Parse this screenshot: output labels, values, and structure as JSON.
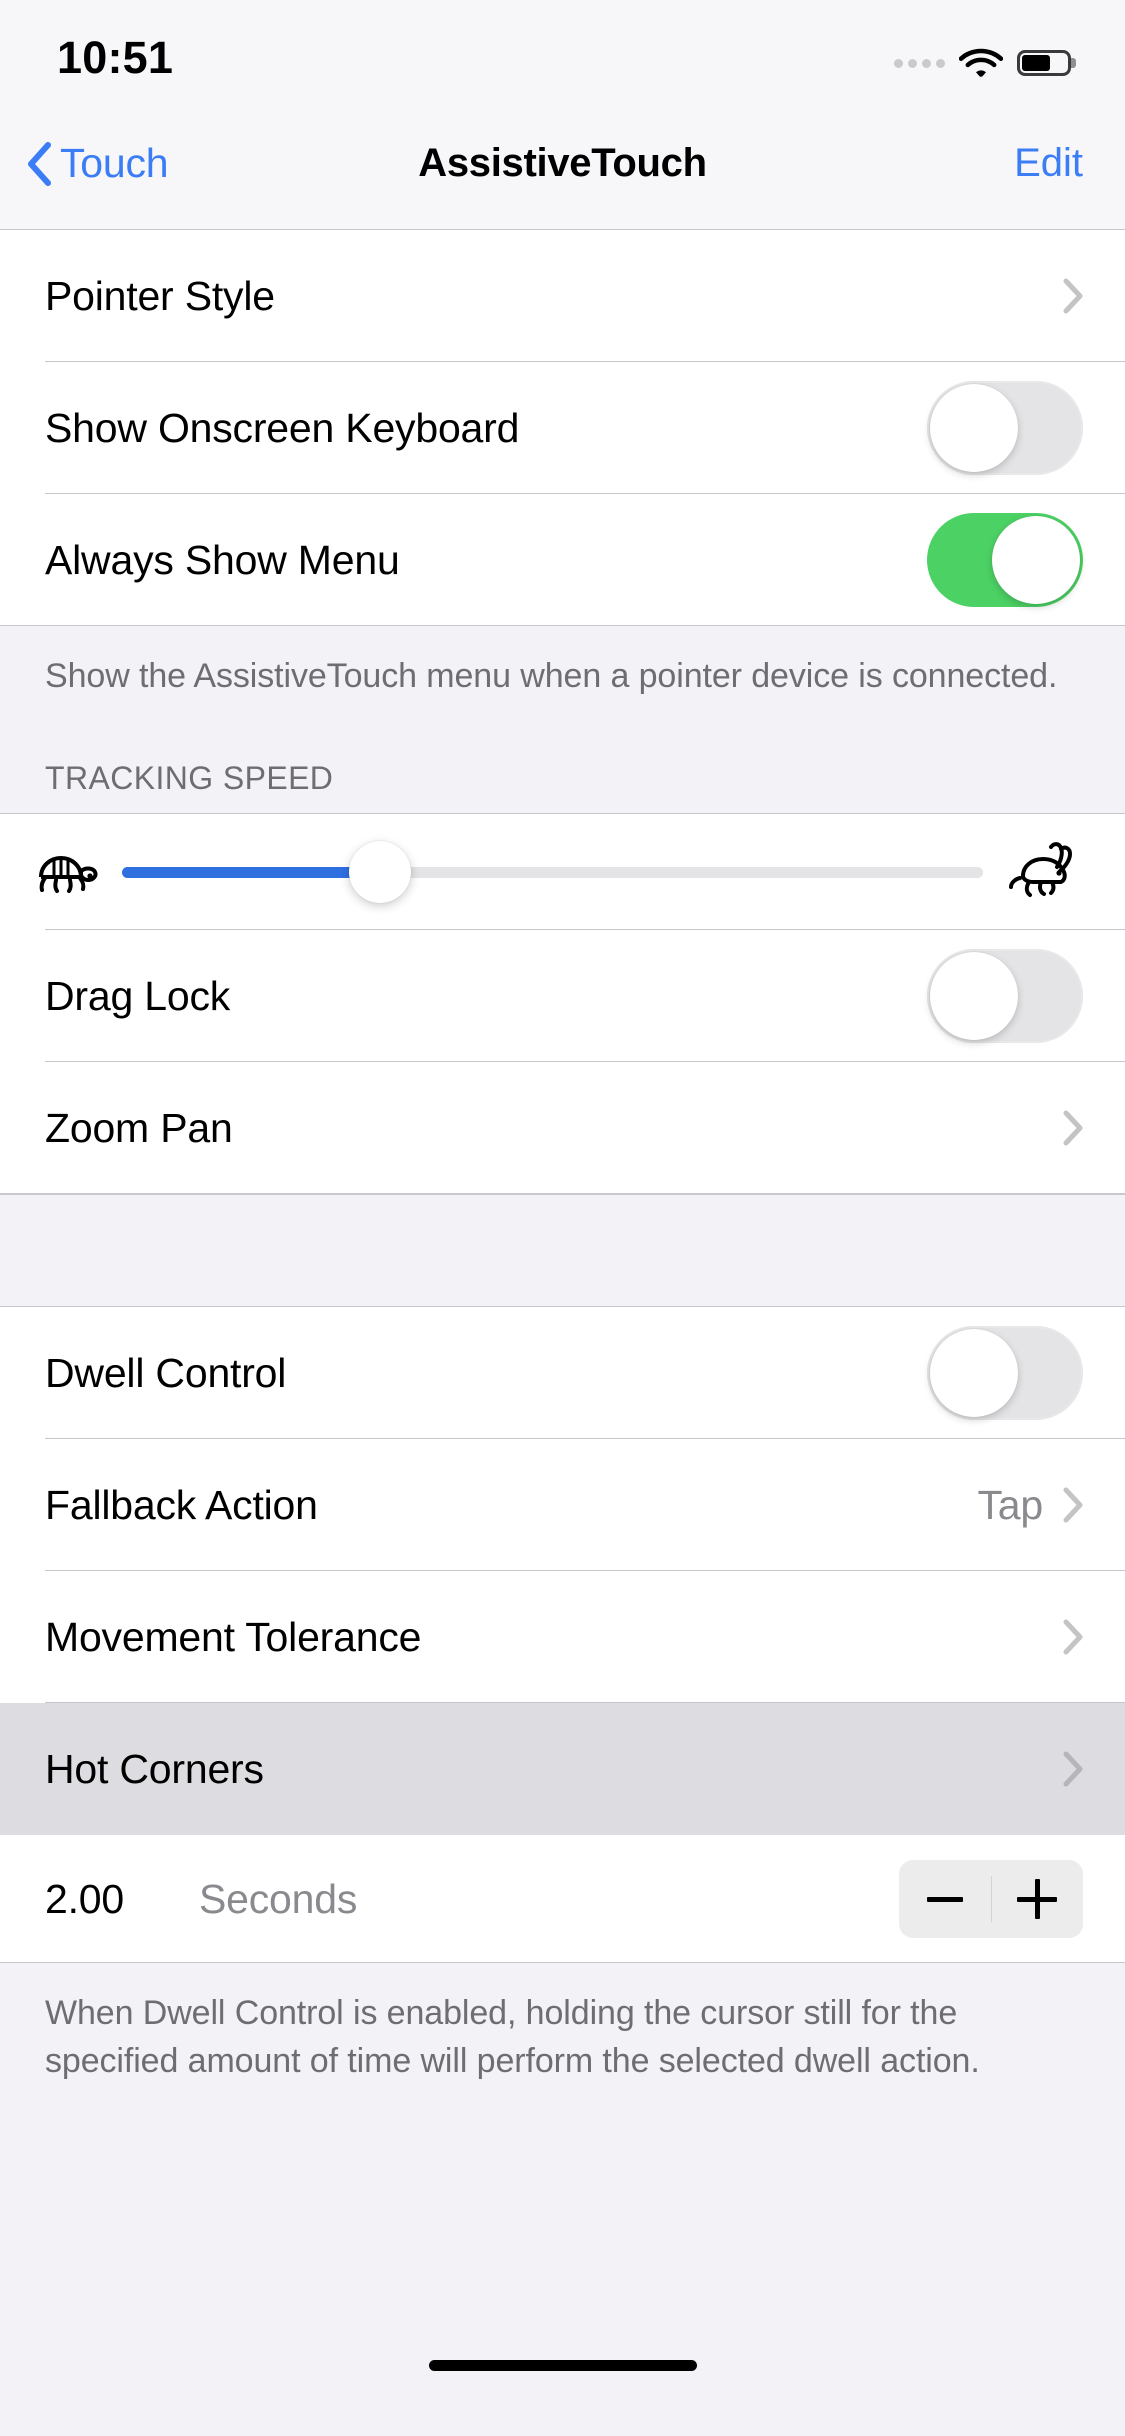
{
  "status_bar": {
    "time": "10:51",
    "cellular_icon": "cellular-dots-icon",
    "wifi_icon": "wifi-icon",
    "battery_icon": "battery-icon",
    "battery_level_percent": 62
  },
  "nav": {
    "back_label": "Touch",
    "back_icon": "chevron-left-icon",
    "title": "AssistiveTouch",
    "edit_label": "Edit"
  },
  "section_pointer": {
    "rows": [
      {
        "label": "Pointer Style",
        "type": "disclosure",
        "accessory_icon": "chevron-right-icon"
      },
      {
        "label": "Show Onscreen Keyboard",
        "type": "switch",
        "value": "off"
      },
      {
        "label": "Always Show Menu",
        "type": "switch",
        "value": "on"
      }
    ],
    "footer": "Show the AssistiveTouch menu when a pointer device is connected."
  },
  "section_tracking": {
    "header": "TRACKING SPEED",
    "slider": {
      "min_icon": "tortoise-icon",
      "max_icon": "hare-icon",
      "value_percent": 30
    },
    "rows": [
      {
        "label": "Drag Lock",
        "type": "switch",
        "value": "off"
      },
      {
        "label": "Zoom Pan",
        "type": "disclosure",
        "accessory_icon": "chevron-right-icon"
      }
    ]
  },
  "section_dwell": {
    "rows": [
      {
        "label": "Dwell Control",
        "type": "switch",
        "value": "off"
      },
      {
        "label": "Fallback Action",
        "type": "disclosure",
        "value": "Tap",
        "accessory_icon": "chevron-right-icon"
      },
      {
        "label": "Movement Tolerance",
        "type": "disclosure",
        "accessory_icon": "chevron-right-icon"
      },
      {
        "label": "Hot Corners",
        "type": "disclosure",
        "accessory_icon": "chevron-right-icon",
        "selected": true
      }
    ],
    "stepper": {
      "value": "2.00",
      "unit": "Seconds",
      "decrement_icon": "minus-icon",
      "increment_icon": "plus-icon"
    },
    "footer": "When Dwell Control is enabled, holding the cursor still for the specified amount of time will perform the selected dwell action."
  },
  "colors": {
    "accent_blue": "#3b7df4",
    "switch_on_green": "#4cd164",
    "slider_blue": "#2f6fe0",
    "selected_row": "#dcdce1",
    "group_background": "#f2f2f7"
  }
}
